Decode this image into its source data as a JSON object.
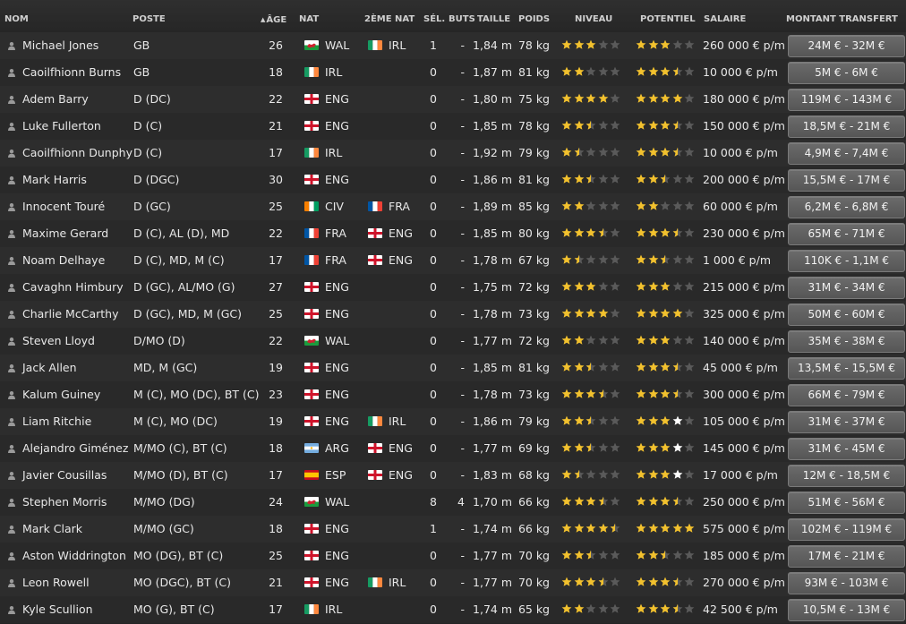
{
  "headers": {
    "name": "NOM",
    "position": "POSTE",
    "age": "ÂGE",
    "nat": "NAT",
    "nat2": "2ÈME NAT",
    "sel": "SÉL.",
    "goals": "BUTS",
    "height": "TAILLE",
    "weight": "POIDS",
    "ability": "NIVEAU",
    "potential": "POTENTIEL",
    "salary": "SALAIRE",
    "transfer": "MONTANT TRANSFERT"
  },
  "colors": {
    "star_filled": "#f2c12e",
    "star_empty": "#5a5a5a",
    "star_white": "#ffffff"
  },
  "players": [
    {
      "name": "Michael Jones",
      "position": "GB",
      "age": "26",
      "nat": "WAL",
      "nat2": "IRL",
      "sel": "1",
      "goals": "-",
      "height": "1,84 m",
      "weight": "78 kg",
      "ability": 3,
      "potential": 3,
      "potential_white": 0,
      "salary": "260 000 € p/m",
      "transfer": "24M € - 32M €"
    },
    {
      "name": "Caoilfhionn Burns",
      "position": "GB",
      "age": "18",
      "nat": "IRL",
      "nat2": "",
      "sel": "0",
      "goals": "-",
      "height": "1,87 m",
      "weight": "81 kg",
      "ability": 2,
      "potential": 3.5,
      "potential_white": 0,
      "salary": "10 000 € p/m",
      "transfer": "5M € - 6M €"
    },
    {
      "name": "Adem Barry",
      "position": "D (DC)",
      "age": "22",
      "nat": "ENG",
      "nat2": "",
      "sel": "0",
      "goals": "-",
      "height": "1,80 m",
      "weight": "75 kg",
      "ability": 4,
      "potential": 4,
      "potential_white": 0,
      "salary": "180 000 € p/m",
      "transfer": "119M € - 143M €"
    },
    {
      "name": "Luke Fullerton",
      "position": "D (C)",
      "age": "21",
      "nat": "ENG",
      "nat2": "",
      "sel": "0",
      "goals": "-",
      "height": "1,85 m",
      "weight": "78 kg",
      "ability": 2.5,
      "potential": 3.5,
      "potential_white": 0,
      "salary": "150 000 € p/m",
      "transfer": "18,5M € - 21M €"
    },
    {
      "name": "Caoilfhionn Dunphy",
      "position": "D (C)",
      "age": "17",
      "nat": "IRL",
      "nat2": "",
      "sel": "0",
      "goals": "-",
      "height": "1,92 m",
      "weight": "79 kg",
      "ability": 1.5,
      "potential": 3.5,
      "potential_white": 0,
      "salary": "10 000 € p/m",
      "transfer": "4,9M € - 7,4M €"
    },
    {
      "name": "Mark Harris",
      "position": "D (DGC)",
      "age": "30",
      "nat": "ENG",
      "nat2": "",
      "sel": "0",
      "goals": "-",
      "height": "1,86 m",
      "weight": "81 kg",
      "ability": 2.5,
      "potential": 2.5,
      "potential_white": 0,
      "salary": "200 000 € p/m",
      "transfer": "15,5M € - 17M €"
    },
    {
      "name": "Innocent Touré",
      "position": "D (GC)",
      "age": "25",
      "nat": "CIV",
      "nat2": "FRA",
      "sel": "0",
      "goals": "-",
      "height": "1,89 m",
      "weight": "85 kg",
      "ability": 2,
      "potential": 2,
      "potential_white": 0,
      "salary": "60 000 € p/m",
      "transfer": "6,2M € - 6,8M €"
    },
    {
      "name": "Maxime Gerard",
      "position": "D (C), AL (D), MD",
      "age": "22",
      "nat": "FRA",
      "nat2": "ENG",
      "sel": "0",
      "goals": "-",
      "height": "1,85 m",
      "weight": "80 kg",
      "ability": 3.5,
      "potential": 3.5,
      "potential_white": 0,
      "salary": "230 000 € p/m",
      "transfer": "65M € - 71M €"
    },
    {
      "name": "Noam Delhaye",
      "position": "D (C), MD, M (C)",
      "age": "17",
      "nat": "FRA",
      "nat2": "ENG",
      "sel": "0",
      "goals": "-",
      "height": "1,78 m",
      "weight": "67 kg",
      "ability": 1.5,
      "potential": 2.5,
      "potential_white": 0,
      "salary": "1 000 € p/m",
      "transfer": "110K € - 1,1M €"
    },
    {
      "name": "Cavaghn Himbury",
      "position": "D (GC), AL/MO (G)",
      "age": "27",
      "nat": "ENG",
      "nat2": "",
      "sel": "0",
      "goals": "-",
      "height": "1,75 m",
      "weight": "72 kg",
      "ability": 3,
      "potential": 3,
      "potential_white": 0,
      "salary": "215 000 € p/m",
      "transfer": "31M € - 34M €"
    },
    {
      "name": "Charlie McCarthy",
      "position": "D (GC), MD, M (GC)",
      "age": "25",
      "nat": "ENG",
      "nat2": "",
      "sel": "0",
      "goals": "-",
      "height": "1,78 m",
      "weight": "73 kg",
      "ability": 4,
      "potential": 4,
      "potential_white": 0,
      "salary": "325 000 € p/m",
      "transfer": "50M € - 60M €"
    },
    {
      "name": "Steven Lloyd",
      "position": "D/MO (D)",
      "age": "22",
      "nat": "WAL",
      "nat2": "",
      "sel": "0",
      "goals": "-",
      "height": "1,77 m",
      "weight": "72 kg",
      "ability": 2,
      "potential": 3,
      "potential_white": 0,
      "salary": "140 000 € p/m",
      "transfer": "35M € - 38M €"
    },
    {
      "name": "Jack Allen",
      "position": "MD, M (GC)",
      "age": "19",
      "nat": "ENG",
      "nat2": "",
      "sel": "0",
      "goals": "-",
      "height": "1,85 m",
      "weight": "81 kg",
      "ability": 2.5,
      "potential": 3.5,
      "potential_white": 0,
      "salary": "45 000 € p/m",
      "transfer": "13,5M € - 15,5M €"
    },
    {
      "name": "Kalum Guiney",
      "position": "M (C), MO (DC), BT (C)",
      "age": "23",
      "nat": "ENG",
      "nat2": "",
      "sel": "0",
      "goals": "-",
      "height": "1,78 m",
      "weight": "73 kg",
      "ability": 3.5,
      "potential": 3.5,
      "potential_white": 0,
      "salary": "300 000 € p/m",
      "transfer": "66M € - 79M €"
    },
    {
      "name": "Liam Ritchie",
      "position": "M (C), MO (DC)",
      "age": "19",
      "nat": "ENG",
      "nat2": "IRL",
      "sel": "0",
      "goals": "-",
      "height": "1,86 m",
      "weight": "79 kg",
      "ability": 2.5,
      "potential": 3,
      "potential_white": 1,
      "salary": "105 000 € p/m",
      "transfer": "31M € - 37M €"
    },
    {
      "name": "Alejandro Giménez",
      "position": "M/MO (C), BT (C)",
      "age": "18",
      "nat": "ARG",
      "nat2": "ENG",
      "sel": "0",
      "goals": "-",
      "height": "1,77 m",
      "weight": "69 kg",
      "ability": 2.5,
      "potential": 3,
      "potential_white": 1,
      "salary": "145 000 € p/m",
      "transfer": "31M € - 45M €"
    },
    {
      "name": "Javier Cousillas",
      "position": "M/MO (D), BT (C)",
      "age": "17",
      "nat": "ESP",
      "nat2": "ENG",
      "sel": "0",
      "goals": "-",
      "height": "1,83 m",
      "weight": "68 kg",
      "ability": 1.5,
      "potential": 3,
      "potential_white": 1,
      "salary": "17 000 € p/m",
      "transfer": "12M € - 18,5M €"
    },
    {
      "name": "Stephen Morris",
      "position": "M/MO (DG)",
      "age": "24",
      "nat": "WAL",
      "nat2": "",
      "sel": "8",
      "goals": "4",
      "height": "1,70 m",
      "weight": "66 kg",
      "ability": 3.5,
      "potential": 3.5,
      "potential_white": 0,
      "salary": "250 000 € p/m",
      "transfer": "51M € - 56M €"
    },
    {
      "name": "Mark Clark",
      "position": "M/MO (GC)",
      "age": "18",
      "nat": "ENG",
      "nat2": "",
      "sel": "1",
      "goals": "-",
      "height": "1,74 m",
      "weight": "66 kg",
      "ability": 4.5,
      "potential": 5,
      "potential_white": 0,
      "salary": "575 000 € p/m",
      "transfer": "102M € - 119M €"
    },
    {
      "name": "Aston Widdrington",
      "position": "MO (DG), BT (C)",
      "age": "25",
      "nat": "ENG",
      "nat2": "",
      "sel": "0",
      "goals": "-",
      "height": "1,77 m",
      "weight": "70 kg",
      "ability": 2.5,
      "potential": 2.5,
      "potential_white": 0,
      "salary": "185 000 € p/m",
      "transfer": "17M € - 21M €"
    },
    {
      "name": "Leon Rowell",
      "position": "MO (DGC), BT (C)",
      "age": "21",
      "nat": "ENG",
      "nat2": "IRL",
      "sel": "0",
      "goals": "-",
      "height": "1,77 m",
      "weight": "70 kg",
      "ability": 3.5,
      "potential": 3.5,
      "potential_white": 0,
      "salary": "270 000 € p/m",
      "transfer": "93M € - 103M €"
    },
    {
      "name": "Kyle Scullion",
      "position": "MO (G), BT (C)",
      "age": "17",
      "nat": "IRL",
      "nat2": "",
      "sel": "0",
      "goals": "-",
      "height": "1,74 m",
      "weight": "65 kg",
      "ability": 2,
      "potential": 3.5,
      "potential_white": 0,
      "salary": "42 500 € p/m",
      "transfer": "10,5M € - 13M €"
    }
  ]
}
